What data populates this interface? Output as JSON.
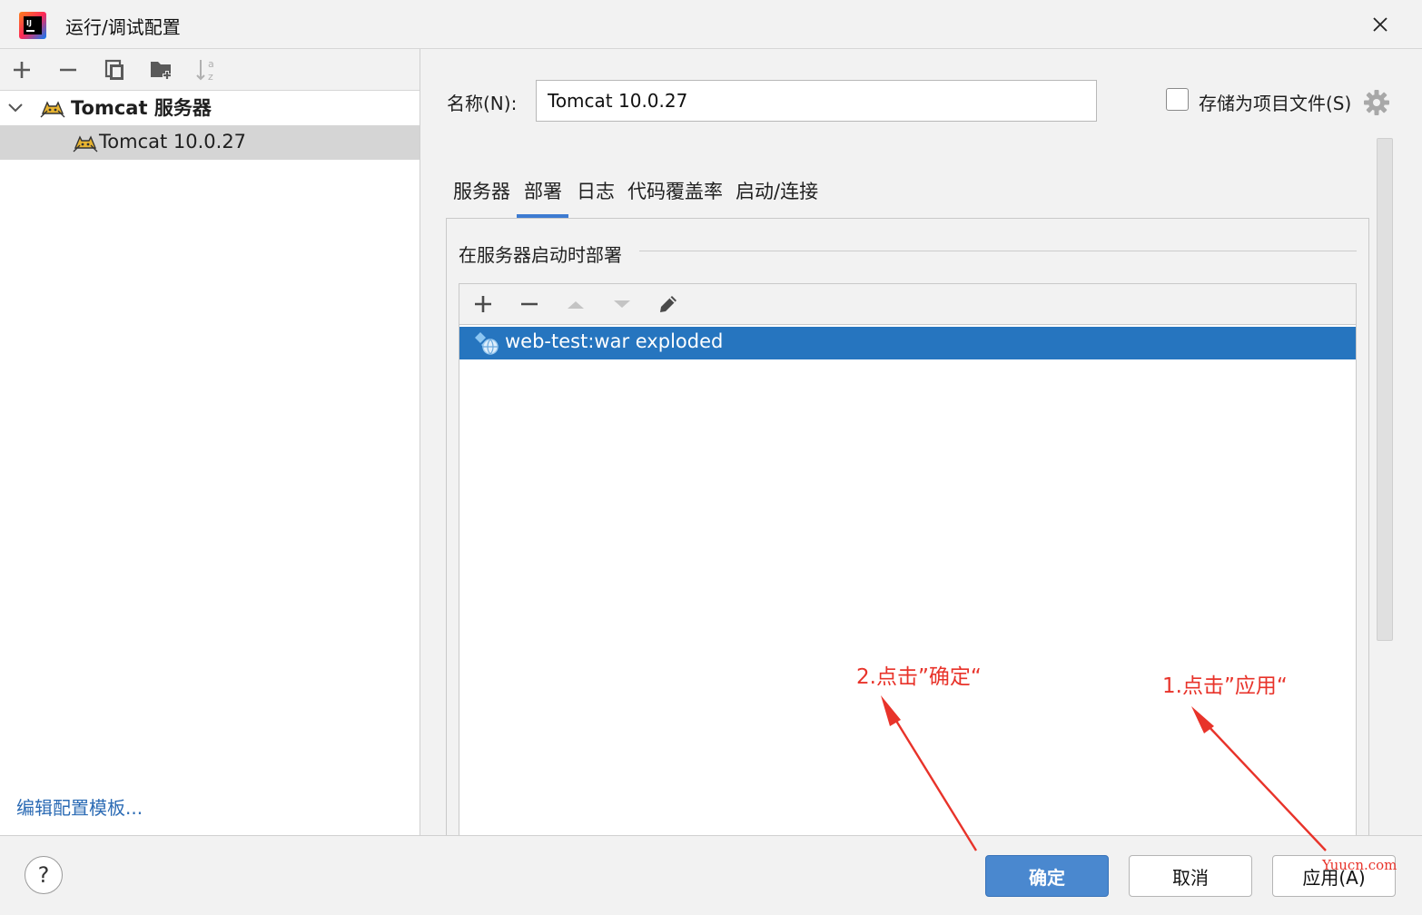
{
  "window": {
    "title": "运行/调试配置",
    "close_glyph": "✕"
  },
  "left": {
    "toolbar": [
      "add",
      "remove",
      "copy",
      "new-folder",
      "sort"
    ],
    "tree": {
      "group_label": "Tomcat 服务器",
      "item_label": "Tomcat 10.0.27"
    },
    "edit_templates": "编辑配置模板..."
  },
  "form": {
    "name_label": "名称(N):",
    "name_value": "Tomcat 10.0.27",
    "store_label": "存储为项目文件(S)",
    "store_checked": false
  },
  "tabs": [
    {
      "label": "服务器",
      "active": false
    },
    {
      "label": "部署",
      "active": true
    },
    {
      "label": "日志",
      "active": false
    },
    {
      "label": "代码覆盖率",
      "active": false
    },
    {
      "label": "启动/连接",
      "active": false
    }
  ],
  "deploy": {
    "section_title": "在服务器启动时部署",
    "toolbar": [
      "add",
      "remove",
      "move-up",
      "move-down",
      "edit"
    ],
    "artifacts": [
      {
        "label": "web-test:war exploded",
        "selected": true
      }
    ]
  },
  "buttons": {
    "help": "?",
    "ok": "确定",
    "cancel": "取消",
    "apply": "应用(A)"
  },
  "annotations": {
    "step2": "2.点击”确定“",
    "step1": "1.点击”应用“",
    "color": "#e8332a"
  },
  "watermark": "Yuucn.com",
  "colors": {
    "accent": "#3d7bd1",
    "selection": "#2675bf",
    "ok_button": "#4a88cf"
  }
}
